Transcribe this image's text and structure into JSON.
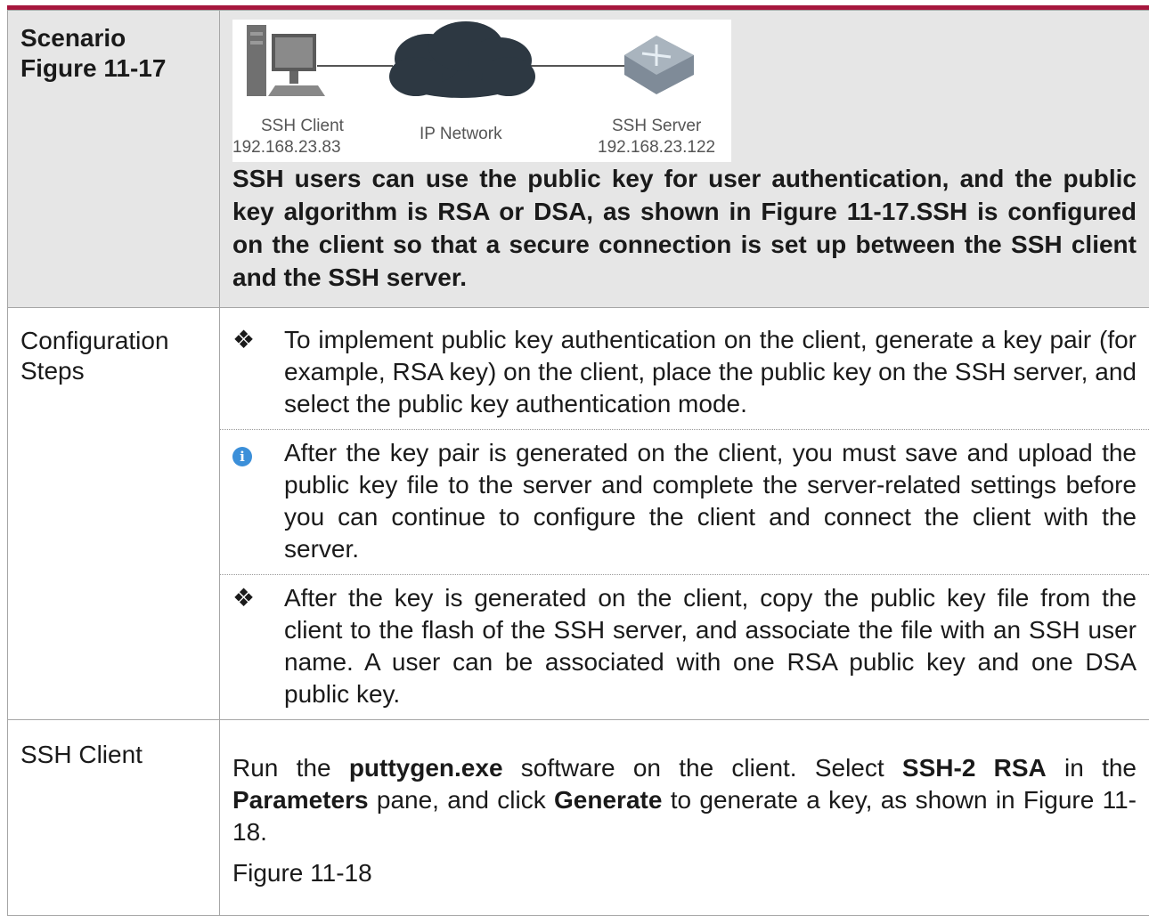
{
  "scenario": {
    "label_line1": "Scenario",
    "label_line2": "Figure 11-17",
    "network": {
      "client_name": "SSH Client",
      "client_ip": "192.168.23.83",
      "network_name": "IP Network",
      "server_name": "SSH Server",
      "server_ip": "192.168.23.122"
    },
    "description": "SSH users can use the public key for user authentication, and the public key algorithm is RSA or DSA, as shown in Figure 11-17.SSH is configured on the client so that a secure connection is set up between the SSH client and the SSH server."
  },
  "config": {
    "label_line1": "Configuration",
    "label_line2": "Steps",
    "bullet_glyph": "❖",
    "step1": "To implement public key authentication on the client, generate a key pair (for example, RSA key) on the client, place the public key on the SSH server, and select the public key authentication mode.",
    "note_icon": "i",
    "note": "After the key pair is generated on the client, you must save and upload the public key file to the server and complete the server-related settings before you can continue to configure the client and connect the client with the server.",
    "step2": "After the key is generated on the client, copy the public key file from the client to the flash of the SSH server, and associate the file with an SSH user name. A user can be associated with one RSA public key and one DSA public key."
  },
  "client": {
    "label": "SSH Client",
    "p_run": "Run the",
    "p_prog": "puttygen.exe",
    "p_mid1": "software on the client. Select",
    "p_alg": "SSH-2 RSA",
    "p_mid2": "in the",
    "p_pane": "Parameters",
    "p_mid3": "pane, and click",
    "p_btn": "Generate",
    "p_end": "to generate a key, as shown in Figure 11-18.",
    "figure_caption": "Figure 11-18"
  },
  "colors": {
    "accent_bar": "#a6173d",
    "scenario_bg": "#e6e6e6",
    "info_icon": "#3b8fd9"
  }
}
